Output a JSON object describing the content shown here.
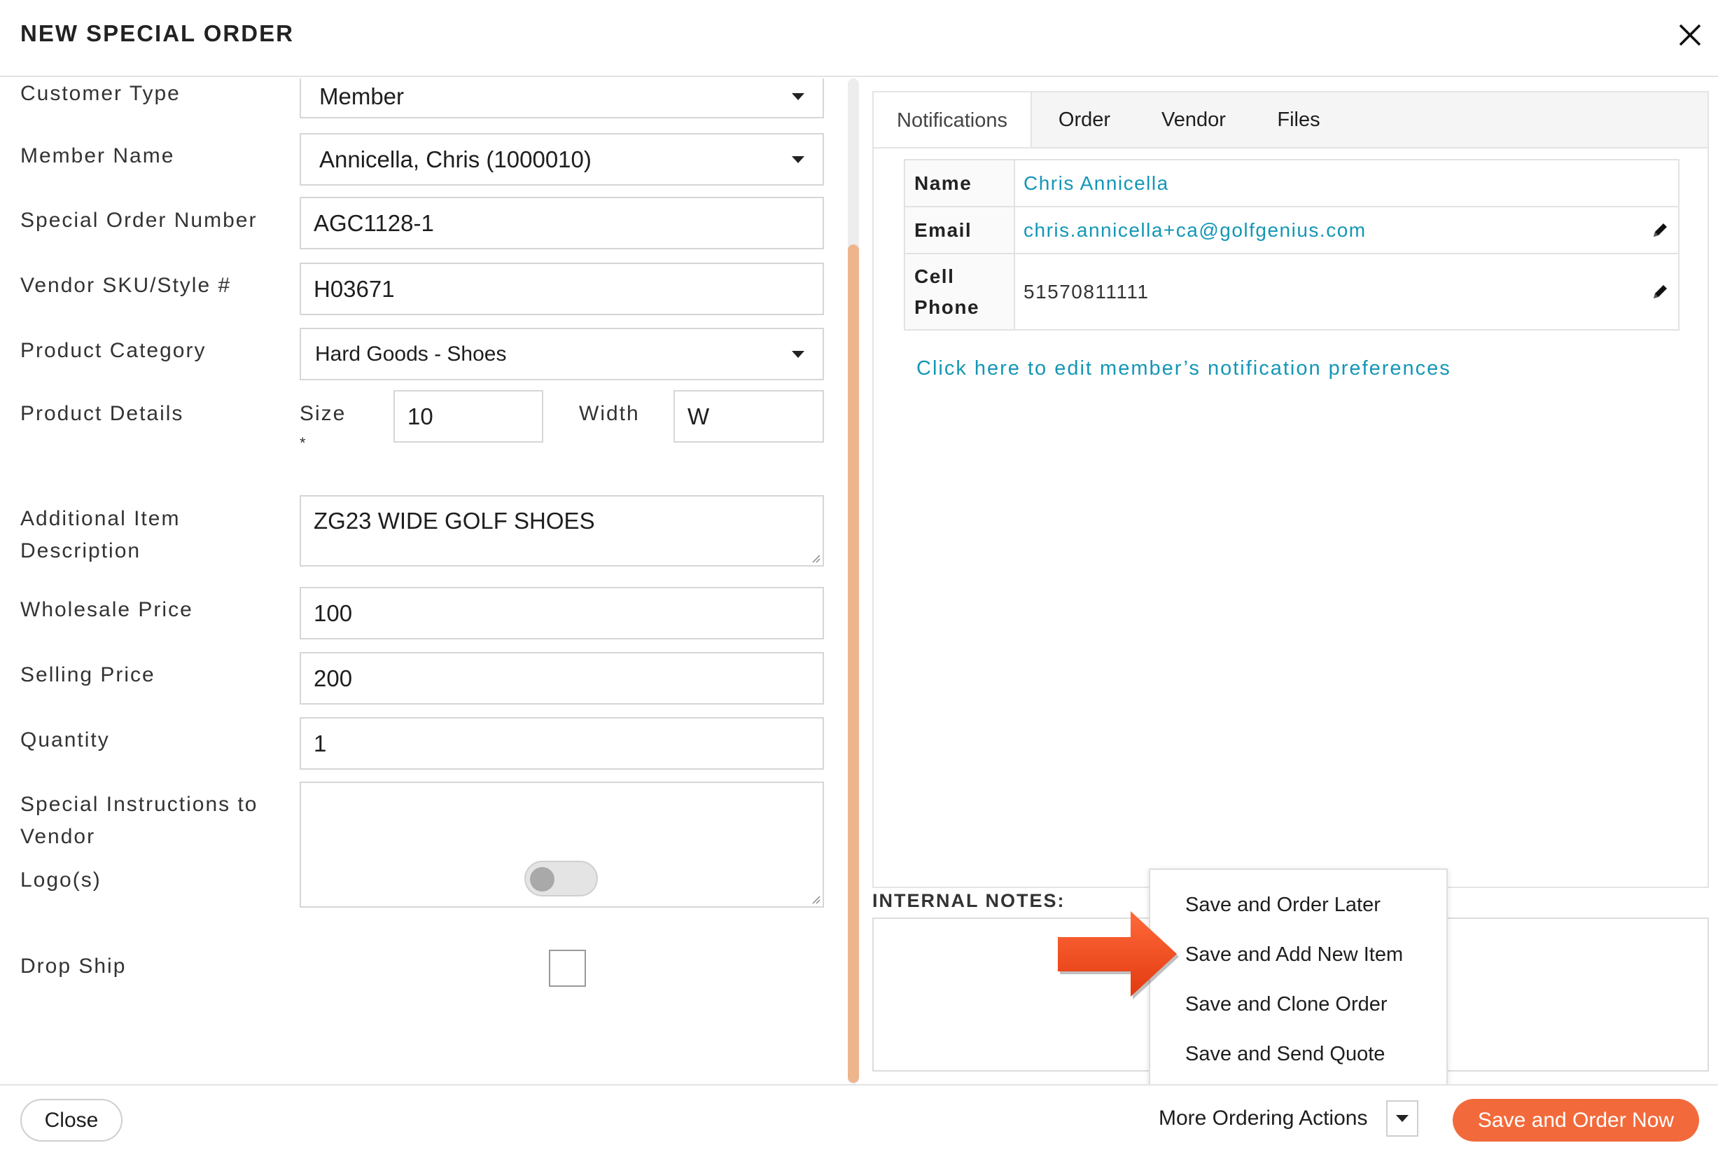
{
  "dialog": {
    "title": "NEW SPECIAL ORDER"
  },
  "form": {
    "customer_type": {
      "label": "Customer Type",
      "value": "Member"
    },
    "member_name": {
      "label": "Member Name",
      "value": "Annicella, Chris (1000010)"
    },
    "order_number": {
      "label": "Special Order Number",
      "value": "AGC1128-1"
    },
    "vendor_sku": {
      "label": "Vendor SKU/Style #",
      "value": "H03671"
    },
    "product_category": {
      "label": "Product Category",
      "value": "Hard Goods - Shoes"
    },
    "product_details": {
      "label": "Product Details",
      "size_label": "Size",
      "required_mark": "*",
      "size_value": "10",
      "width_label": "Width",
      "width_value": "W"
    },
    "additional_desc": {
      "label_line1": "Additional Item",
      "label_line2": "Description",
      "value": "ZG23 WIDE GOLF SHOES"
    },
    "wholesale_price": {
      "label": "Wholesale Price",
      "value": "100"
    },
    "selling_price": {
      "label": "Selling Price",
      "value": "200"
    },
    "quantity": {
      "label": "Quantity",
      "value": "1"
    },
    "special_instructions": {
      "label_line1": "Special Instructions to",
      "label_line2": "Vendor",
      "value": ""
    },
    "logos": {
      "label": "Logo(s)",
      "enabled": false
    },
    "drop_ship": {
      "label": "Drop Ship",
      "checked": false
    }
  },
  "tabs": [
    {
      "label": "Notifications",
      "active": true
    },
    {
      "label": "Order",
      "active": false
    },
    {
      "label": "Vendor",
      "active": false
    },
    {
      "label": "Files",
      "active": false
    }
  ],
  "notifications": {
    "name_key": "Name",
    "name_value": "Chris Annicella",
    "email_key": "Email",
    "email_value": "chris.annicella+ca@golfgenius.com",
    "phone_key_line1": "Cell",
    "phone_key_line2": "Phone",
    "phone_value": "51570811111",
    "pref_link": "Click here to edit member’s notification preferences"
  },
  "internal_notes": {
    "label": "INTERNAL NOTES:"
  },
  "ordering_menu": {
    "items": [
      "Save and Order Later",
      "Save and Add New Item",
      "Save and Clone Order",
      "Save and Send Quote"
    ]
  },
  "footer": {
    "close_label": "Close",
    "more_label": "More Ordering Actions",
    "primary_label": "Save and Order Now"
  },
  "colors": {
    "accent": "#f26a3b",
    "link": "#1496b6",
    "scrollbar": "#eeb58d",
    "arrow": "#f0451a"
  }
}
